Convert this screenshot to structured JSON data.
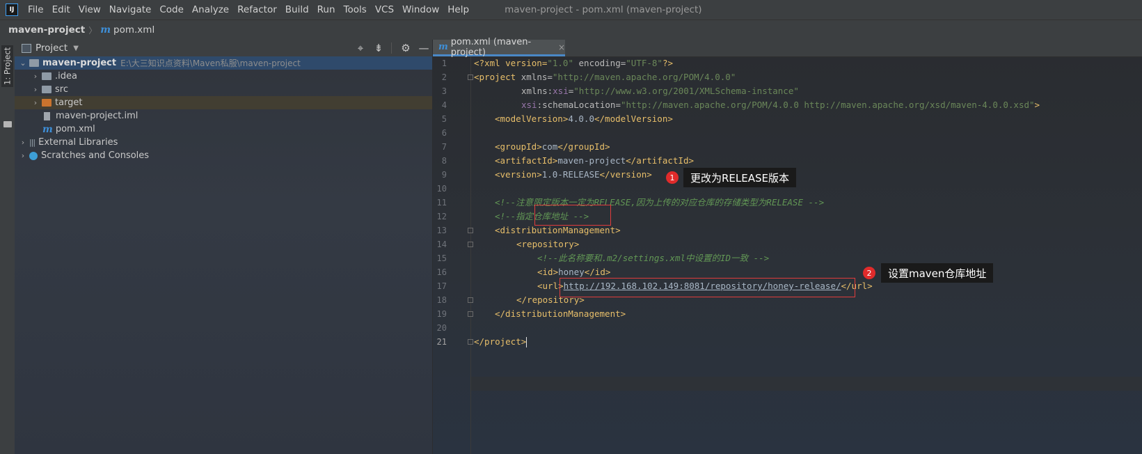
{
  "menubar": {
    "app_icon": "IJ",
    "items": [
      "File",
      "Edit",
      "View",
      "Navigate",
      "Code",
      "Analyze",
      "Refactor",
      "Build",
      "Run",
      "Tools",
      "VCS",
      "Window",
      "Help"
    ],
    "window_title": "maven-project - pom.xml (maven-project)"
  },
  "breadcrumb": {
    "root": "maven-project",
    "file_icon": "m",
    "file": "pom.xml"
  },
  "toolstrip": {
    "project_label": "1: Project"
  },
  "project_panel": {
    "title": "Project",
    "tools": [
      "crosshair-icon",
      "collapse-icon",
      "gear-icon",
      "minimize-icon"
    ],
    "tree": {
      "root_label": "maven-project",
      "root_path": "E:\\大三知识点资料\\Maven私服\\maven-project",
      "idea": ".idea",
      "src": "src",
      "target": "target",
      "iml": "maven-project.iml",
      "pom": "pom.xml",
      "external": "External Libraries",
      "scratches": "Scratches and Consoles"
    }
  },
  "editor": {
    "tab_label": "pom.xml (maven-project)",
    "tab_close": "×",
    "line_numbers": [
      "1",
      "2",
      "3",
      "4",
      "5",
      "6",
      "7",
      "8",
      "9",
      "10",
      "11",
      "12",
      "13",
      "14",
      "15",
      "16",
      "17",
      "18",
      "19",
      "20",
      "21"
    ],
    "current_line": "21",
    "code": {
      "l1_a": "<?xml version=",
      "l1_b": "\"1.0\"",
      "l1_c": " encoding=",
      "l1_d": "\"UTF-8\"",
      "l1_e": "?>",
      "l2_tag": "<project",
      "l2_attr": " xmlns=",
      "l2_val": "\"http://maven.apache.org/POM/4.0.0\"",
      "l3_attr": "xmlns:",
      "l3_ns": "xsi",
      "l3_eq": "=",
      "l3_val": "\"http://www.w3.org/2001/XMLSchema-instance\"",
      "l4_ns": "xsi",
      "l4_attr": ":schemaLocation=",
      "l4_val": "\"http://maven.apache.org/POM/4.0.0 http://maven.apache.org/xsd/maven-4.0.0.xsd\"",
      "l4_end": ">",
      "l5_open": "<modelVersion>",
      "l5_text": "4.0.0",
      "l5_close": "</modelVersion>",
      "l7_open": "<groupId>",
      "l7_text": "com",
      "l7_close": "</groupId>",
      "l8_open": "<artifactId>",
      "l8_text": "maven-project",
      "l8_close": "</artifactId>",
      "l9_open": "<version>",
      "l9_text": "1.0-RELEASE",
      "l9_close": "</version>",
      "l11": "<!--注意限定版本一定为RELEASE,因为上传的对应仓库的存储类型为RELEASE -->",
      "l12": "<!--指定仓库地址 -->",
      "l13": "<distributionManagement>",
      "l14": "<repository>",
      "l15": "<!--此名称要和.m2/settings.xml中设置的ID一致 -->",
      "l16_open": "<id>",
      "l16_text": "honey",
      "l16_close": "</id>",
      "l17_open": "<url>",
      "l17_text": "http://192.168.102.149:8081/repository/honey-release/",
      "l17_close": "</url>",
      "l18": "</repository>",
      "l19": "</distributionManagement>",
      "l21": "</project>"
    }
  },
  "annotations": {
    "badge1": "1",
    "callout1": "更改为RELEASE版本",
    "badge2": "2",
    "callout2": "设置maven仓库地址"
  }
}
